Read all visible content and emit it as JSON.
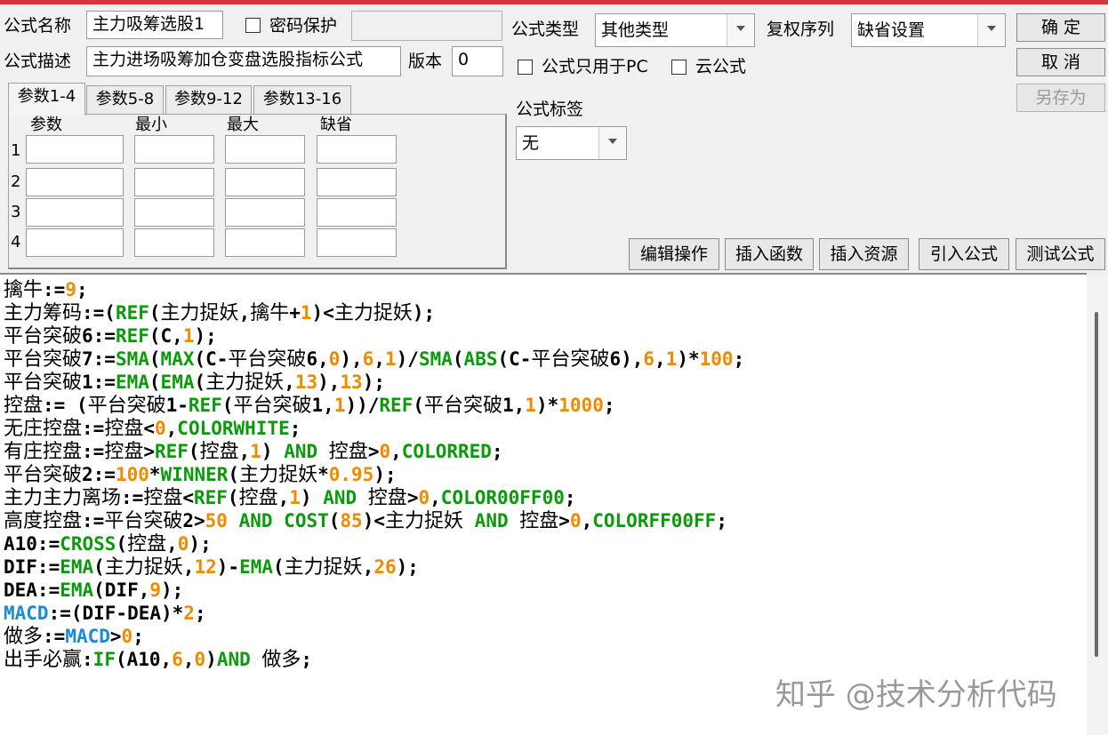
{
  "header": {
    "name_label": "公式名称",
    "name_value": "主力吸筹选股1",
    "password_label": "密码保护",
    "type_label": "公式类型",
    "type_value": "其他类型",
    "rights_label": "复权序列",
    "rights_value": "缺省设置",
    "desc_label": "公式描述",
    "desc_value": "主力进场吸筹加仓变盘选股指标公式",
    "version_label": "版本",
    "version_value": "0",
    "pc_only_label": "公式只用于PC",
    "cloud_label": "云公式",
    "tag_label": "公式标签",
    "tag_value": "无"
  },
  "buttons": {
    "ok": "确 定",
    "cancel": "取 消",
    "save_as": "另存为",
    "edit": "编辑操作",
    "insert_fn": "插入函数",
    "insert_res": "插入资源",
    "import": "引入公式",
    "test": "测试公式"
  },
  "tabs": [
    "参数1-4",
    "参数5-8",
    "参数9-12",
    "参数13-16"
  ],
  "params": {
    "headers": [
      "参数",
      "最小",
      "最大",
      "缺省"
    ],
    "rows": [
      "1",
      "2",
      "3",
      "4"
    ]
  },
  "code_lines": [
    [
      [
        "t-plain",
        "擒牛"
      ],
      [
        "t-op",
        ":="
      ],
      [
        "t-num",
        "9"
      ],
      [
        "t-op",
        ";"
      ]
    ],
    [
      [
        "t-plain",
        "主力筹码"
      ],
      [
        "t-op",
        ":=("
      ],
      [
        "t-fn",
        "REF"
      ],
      [
        "t-op",
        "("
      ],
      [
        "t-plain",
        "主力捉妖"
      ],
      [
        "t-op",
        ","
      ],
      [
        "t-plain",
        "擒牛"
      ],
      [
        "t-op",
        "+"
      ],
      [
        "t-num",
        "1"
      ],
      [
        "t-op",
        ")<"
      ],
      [
        "t-plain",
        "主力捉妖"
      ],
      [
        "t-op",
        ");"
      ]
    ],
    [
      [
        "t-plain",
        "平台突破"
      ],
      [
        "t-op",
        "6:="
      ],
      [
        "t-fn",
        "REF"
      ],
      [
        "t-op",
        "(C,"
      ],
      [
        "t-num",
        "1"
      ],
      [
        "t-op",
        ");"
      ]
    ],
    [
      [
        "t-plain",
        "平台突破"
      ],
      [
        "t-op",
        "7:="
      ],
      [
        "t-fn",
        "SMA"
      ],
      [
        "t-op",
        "("
      ],
      [
        "t-fn",
        "MAX"
      ],
      [
        "t-op",
        "(C-"
      ],
      [
        "t-plain",
        "平台突破"
      ],
      [
        "t-op",
        "6,"
      ],
      [
        "t-num",
        "0"
      ],
      [
        "t-op",
        "),"
      ],
      [
        "t-num",
        "6"
      ],
      [
        "t-op",
        ","
      ],
      [
        "t-num",
        "1"
      ],
      [
        "t-op",
        ")/"
      ],
      [
        "t-fn",
        "SMA"
      ],
      [
        "t-op",
        "("
      ],
      [
        "t-fn",
        "ABS"
      ],
      [
        "t-op",
        "(C-"
      ],
      [
        "t-plain",
        "平台突破"
      ],
      [
        "t-op",
        "6),"
      ],
      [
        "t-num",
        "6"
      ],
      [
        "t-op",
        ","
      ],
      [
        "t-num",
        "1"
      ],
      [
        "t-op",
        ")*"
      ],
      [
        "t-num",
        "100"
      ],
      [
        "t-op",
        ";"
      ]
    ],
    [
      [
        "t-plain",
        "平台突破"
      ],
      [
        "t-op",
        "1:="
      ],
      [
        "t-fn",
        "EMA"
      ],
      [
        "t-op",
        "("
      ],
      [
        "t-fn",
        "EMA"
      ],
      [
        "t-op",
        "("
      ],
      [
        "t-plain",
        "主力捉妖"
      ],
      [
        "t-op",
        ","
      ],
      [
        "t-num",
        "13"
      ],
      [
        "t-op",
        "),"
      ],
      [
        "t-num",
        "13"
      ],
      [
        "t-op",
        ");"
      ]
    ],
    [
      [
        "t-plain",
        "控盘"
      ],
      [
        "t-op",
        ":= ("
      ],
      [
        "t-plain",
        "平台突破"
      ],
      [
        "t-op",
        "1-"
      ],
      [
        "t-fn",
        "REF"
      ],
      [
        "t-op",
        "("
      ],
      [
        "t-plain",
        "平台突破"
      ],
      [
        "t-op",
        "1,"
      ],
      [
        "t-num",
        "1"
      ],
      [
        "t-op",
        "))/"
      ],
      [
        "t-fn",
        "REF"
      ],
      [
        "t-op",
        "("
      ],
      [
        "t-plain",
        "平台突破"
      ],
      [
        "t-op",
        "1,"
      ],
      [
        "t-num",
        "1"
      ],
      [
        "t-op",
        ")*"
      ],
      [
        "t-num",
        "1000"
      ],
      [
        "t-op",
        ";"
      ]
    ],
    [
      [
        "t-plain",
        "无庄控盘"
      ],
      [
        "t-op",
        ":="
      ],
      [
        "t-plain",
        "控盘"
      ],
      [
        "t-op",
        "<"
      ],
      [
        "t-num",
        "0"
      ],
      [
        "t-op",
        ","
      ],
      [
        "t-fn",
        "COLORWHITE"
      ],
      [
        "t-op",
        ";"
      ]
    ],
    [
      [
        "t-plain",
        "有庄控盘"
      ],
      [
        "t-op",
        ":="
      ],
      [
        "t-plain",
        "控盘"
      ],
      [
        "t-op",
        ">"
      ],
      [
        "t-fn",
        "REF"
      ],
      [
        "t-op",
        "("
      ],
      [
        "t-plain",
        "控盘"
      ],
      [
        "t-op",
        ","
      ],
      [
        "t-num",
        "1"
      ],
      [
        "t-op",
        ") "
      ],
      [
        "t-fn",
        "AND"
      ],
      [
        "t-op",
        " "
      ],
      [
        "t-plain",
        "控盘"
      ],
      [
        "t-op",
        ">"
      ],
      [
        "t-num",
        "0"
      ],
      [
        "t-op",
        ","
      ],
      [
        "t-fn",
        "COLORRED"
      ],
      [
        "t-op",
        ";"
      ]
    ],
    [
      [
        "t-plain",
        "平台突破"
      ],
      [
        "t-op",
        "2:="
      ],
      [
        "t-num",
        "100"
      ],
      [
        "t-op",
        "*"
      ],
      [
        "t-fn",
        "WINNER"
      ],
      [
        "t-op",
        "("
      ],
      [
        "t-plain",
        "主力捉妖"
      ],
      [
        "t-op",
        "*"
      ],
      [
        "t-num",
        "0.95"
      ],
      [
        "t-op",
        ");"
      ]
    ],
    [
      [
        "t-plain",
        "主力主力离场"
      ],
      [
        "t-op",
        ":="
      ],
      [
        "t-plain",
        "控盘"
      ],
      [
        "t-op",
        "<"
      ],
      [
        "t-fn",
        "REF"
      ],
      [
        "t-op",
        "("
      ],
      [
        "t-plain",
        "控盘"
      ],
      [
        "t-op",
        ","
      ],
      [
        "t-num",
        "1"
      ],
      [
        "t-op",
        ") "
      ],
      [
        "t-fn",
        "AND"
      ],
      [
        "t-op",
        " "
      ],
      [
        "t-plain",
        "控盘"
      ],
      [
        "t-op",
        ">"
      ],
      [
        "t-num",
        "0"
      ],
      [
        "t-op",
        ","
      ],
      [
        "t-fn",
        "COLOR00FF00"
      ],
      [
        "t-op",
        ";"
      ]
    ],
    [
      [
        "t-plain",
        "高度控盘"
      ],
      [
        "t-op",
        ":="
      ],
      [
        "t-plain",
        "平台突破"
      ],
      [
        "t-op",
        "2>"
      ],
      [
        "t-num",
        "50"
      ],
      [
        "t-op",
        " "
      ],
      [
        "t-fn",
        "AND"
      ],
      [
        "t-op",
        " "
      ],
      [
        "t-fn",
        "COST"
      ],
      [
        "t-op",
        "("
      ],
      [
        "t-num",
        "85"
      ],
      [
        "t-op",
        ")<"
      ],
      [
        "t-plain",
        "主力捉妖"
      ],
      [
        "t-op",
        " "
      ],
      [
        "t-fn",
        "AND"
      ],
      [
        "t-op",
        " "
      ],
      [
        "t-plain",
        "控盘"
      ],
      [
        "t-op",
        ">"
      ],
      [
        "t-num",
        "0"
      ],
      [
        "t-op",
        ","
      ],
      [
        "t-fn",
        "COLORFF00FF"
      ],
      [
        "t-op",
        ";"
      ]
    ],
    [
      [
        "t-op",
        "A10:="
      ],
      [
        "t-fn",
        "CROSS"
      ],
      [
        "t-op",
        "("
      ],
      [
        "t-plain",
        "控盘"
      ],
      [
        "t-op",
        ","
      ],
      [
        "t-num",
        "0"
      ],
      [
        "t-op",
        ");"
      ]
    ],
    [
      [
        "t-op",
        "DIF:="
      ],
      [
        "t-fn",
        "EMA"
      ],
      [
        "t-op",
        "("
      ],
      [
        "t-plain",
        "主力捉妖"
      ],
      [
        "t-op",
        ","
      ],
      [
        "t-num",
        "12"
      ],
      [
        "t-op",
        ")-"
      ],
      [
        "t-fn",
        "EMA"
      ],
      [
        "t-op",
        "("
      ],
      [
        "t-plain",
        "主力捉妖"
      ],
      [
        "t-op",
        ","
      ],
      [
        "t-num",
        "26"
      ],
      [
        "t-op",
        ");"
      ]
    ],
    [
      [
        "t-op",
        "DEA:="
      ],
      [
        "t-fn",
        "EMA"
      ],
      [
        "t-op",
        "(DIF,"
      ],
      [
        "t-num",
        "9"
      ],
      [
        "t-op",
        ");"
      ]
    ],
    [
      [
        "t-kw",
        "MACD"
      ],
      [
        "t-op",
        ":=(DIF-DEA)*"
      ],
      [
        "t-num",
        "2"
      ],
      [
        "t-op",
        ";"
      ]
    ],
    [
      [
        "t-plain",
        "做多"
      ],
      [
        "t-op",
        ":="
      ],
      [
        "t-kw",
        "MACD"
      ],
      [
        "t-op",
        ">"
      ],
      [
        "t-num",
        "0"
      ],
      [
        "t-op",
        ";"
      ]
    ],
    [
      [
        "t-plain",
        "出手必赢"
      ],
      [
        "t-op",
        ":"
      ],
      [
        "t-fn",
        "IF"
      ],
      [
        "t-op",
        "(A10,"
      ],
      [
        "t-num",
        "6"
      ],
      [
        "t-op",
        ","
      ],
      [
        "t-num",
        "0"
      ],
      [
        "t-op",
        ")"
      ],
      [
        "t-fn",
        "AND"
      ],
      [
        "t-op",
        " "
      ],
      [
        "t-plain",
        "做多"
      ],
      [
        "t-op",
        ";"
      ]
    ]
  ],
  "watermark": "知乎 @技术分析代码",
  "colors": {
    "accent_bar": "#d9343e",
    "function": "#0a9a0a",
    "number": "#f08a00",
    "keyword": "#1a8ad8"
  }
}
